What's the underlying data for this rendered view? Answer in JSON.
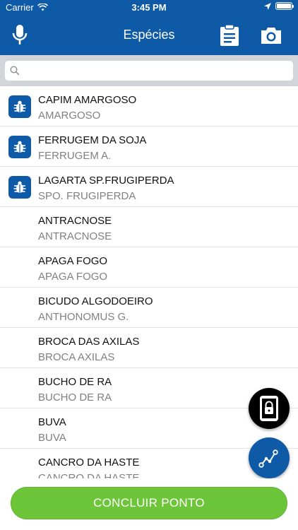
{
  "status_bar": {
    "carrier": "Carrier",
    "time": "3:45 PM",
    "battery_level": 1.0
  },
  "nav": {
    "title": "Espécies",
    "left_icon": "microphone-icon",
    "right_icons": [
      "clipboard-icon",
      "camera-icon"
    ]
  },
  "search": {
    "placeholder": "",
    "value": ""
  },
  "species": [
    {
      "name": "CAPIM AMARGOSO",
      "alias": "AMARGOSO",
      "icon": "bug-icon"
    },
    {
      "name": "FERRUGEM DA SOJA",
      "alias": "FERRUGEM A.",
      "icon": "bug-icon"
    },
    {
      "name": "LAGARTA SP.FRUGIPERDA",
      "alias": "SPO. FRUGIPERDA",
      "icon": "bug-icon"
    },
    {
      "name": "ANTRACNOSE",
      "alias": "ANTRACNOSE",
      "icon": ""
    },
    {
      "name": "APAGA FOGO",
      "alias": "APAGA FOGO",
      "icon": ""
    },
    {
      "name": "BICUDO ALGODOEIRO",
      "alias": "ANTHONOMUS G.",
      "icon": ""
    },
    {
      "name": "BROCA DAS AXILAS",
      "alias": "BROCA AXILAS",
      "icon": ""
    },
    {
      "name": "BUCHO DE RA",
      "alias": "BUCHO DE RA",
      "icon": ""
    },
    {
      "name": "BUVA",
      "alias": "BUVA",
      "icon": ""
    },
    {
      "name": "CANCRO DA HASTE",
      "alias": "CANCRO DA HASTE",
      "icon": ""
    }
  ],
  "fabs": {
    "lock": "phone-lock-icon",
    "route": "route-icon"
  },
  "footer": {
    "conclude_label": "CONCLUIR PONTO"
  },
  "colors": {
    "primary": "#0f5aa6",
    "accent_green": "#6dc53a",
    "search_bg": "#d3d5da",
    "subtitle_gray": "#808080"
  }
}
